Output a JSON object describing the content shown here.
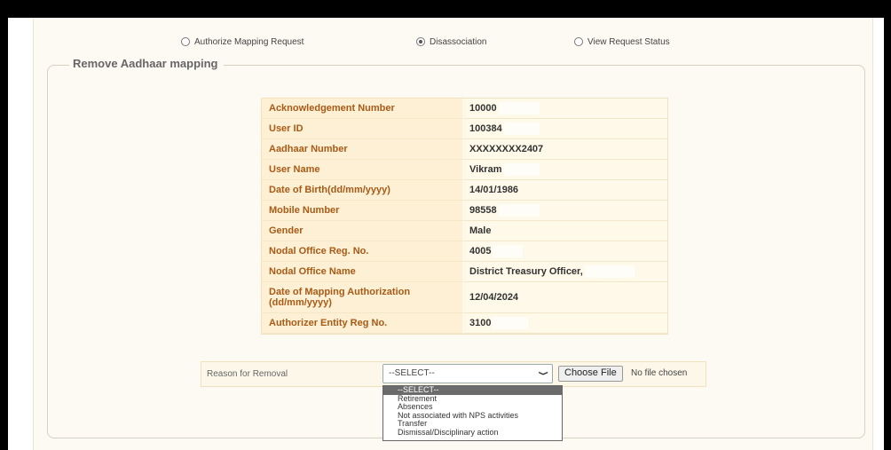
{
  "tabs": [
    {
      "label": "Authorize Mapping Request",
      "checked": false
    },
    {
      "label": "Disassociation",
      "checked": true
    },
    {
      "label": "View Request Status",
      "checked": false
    }
  ],
  "section_title": "Remove Aadhaar mapping",
  "details": [
    {
      "label": "Acknowledgement Number",
      "value": "10000"
    },
    {
      "label": "User ID",
      "value": "100384"
    },
    {
      "label": "Aadhaar Number",
      "value": "XXXXXXXX2407"
    },
    {
      "label": "User Name",
      "value": "Vikram"
    },
    {
      "label": "Date of Birth(dd/mm/yyyy)",
      "value": "14/01/1986"
    },
    {
      "label": "Mobile Number",
      "value": "98558"
    },
    {
      "label": "Gender",
      "value": "Male"
    },
    {
      "label": "Nodal Office Reg. No.",
      "value": "4005"
    },
    {
      "label": "Nodal Office Name",
      "value": "District Treasury Officer,"
    },
    {
      "label": "Date of Mapping Authorization (dd/mm/yyyy)",
      "value": "12/04/2024"
    },
    {
      "label": "Authorizer Entity Reg No.",
      "value": "3100"
    }
  ],
  "removal": {
    "label": "Reason for Removal",
    "selected": "--SELECT--",
    "options": [
      "--SELECT--",
      "Retirement",
      "Absences",
      "Not associated with NPS activities",
      "Transfer",
      "Dismissal/Disciplinary action"
    ],
    "choose_file_label": "Choose File",
    "file_status": "No file chosen"
  }
}
